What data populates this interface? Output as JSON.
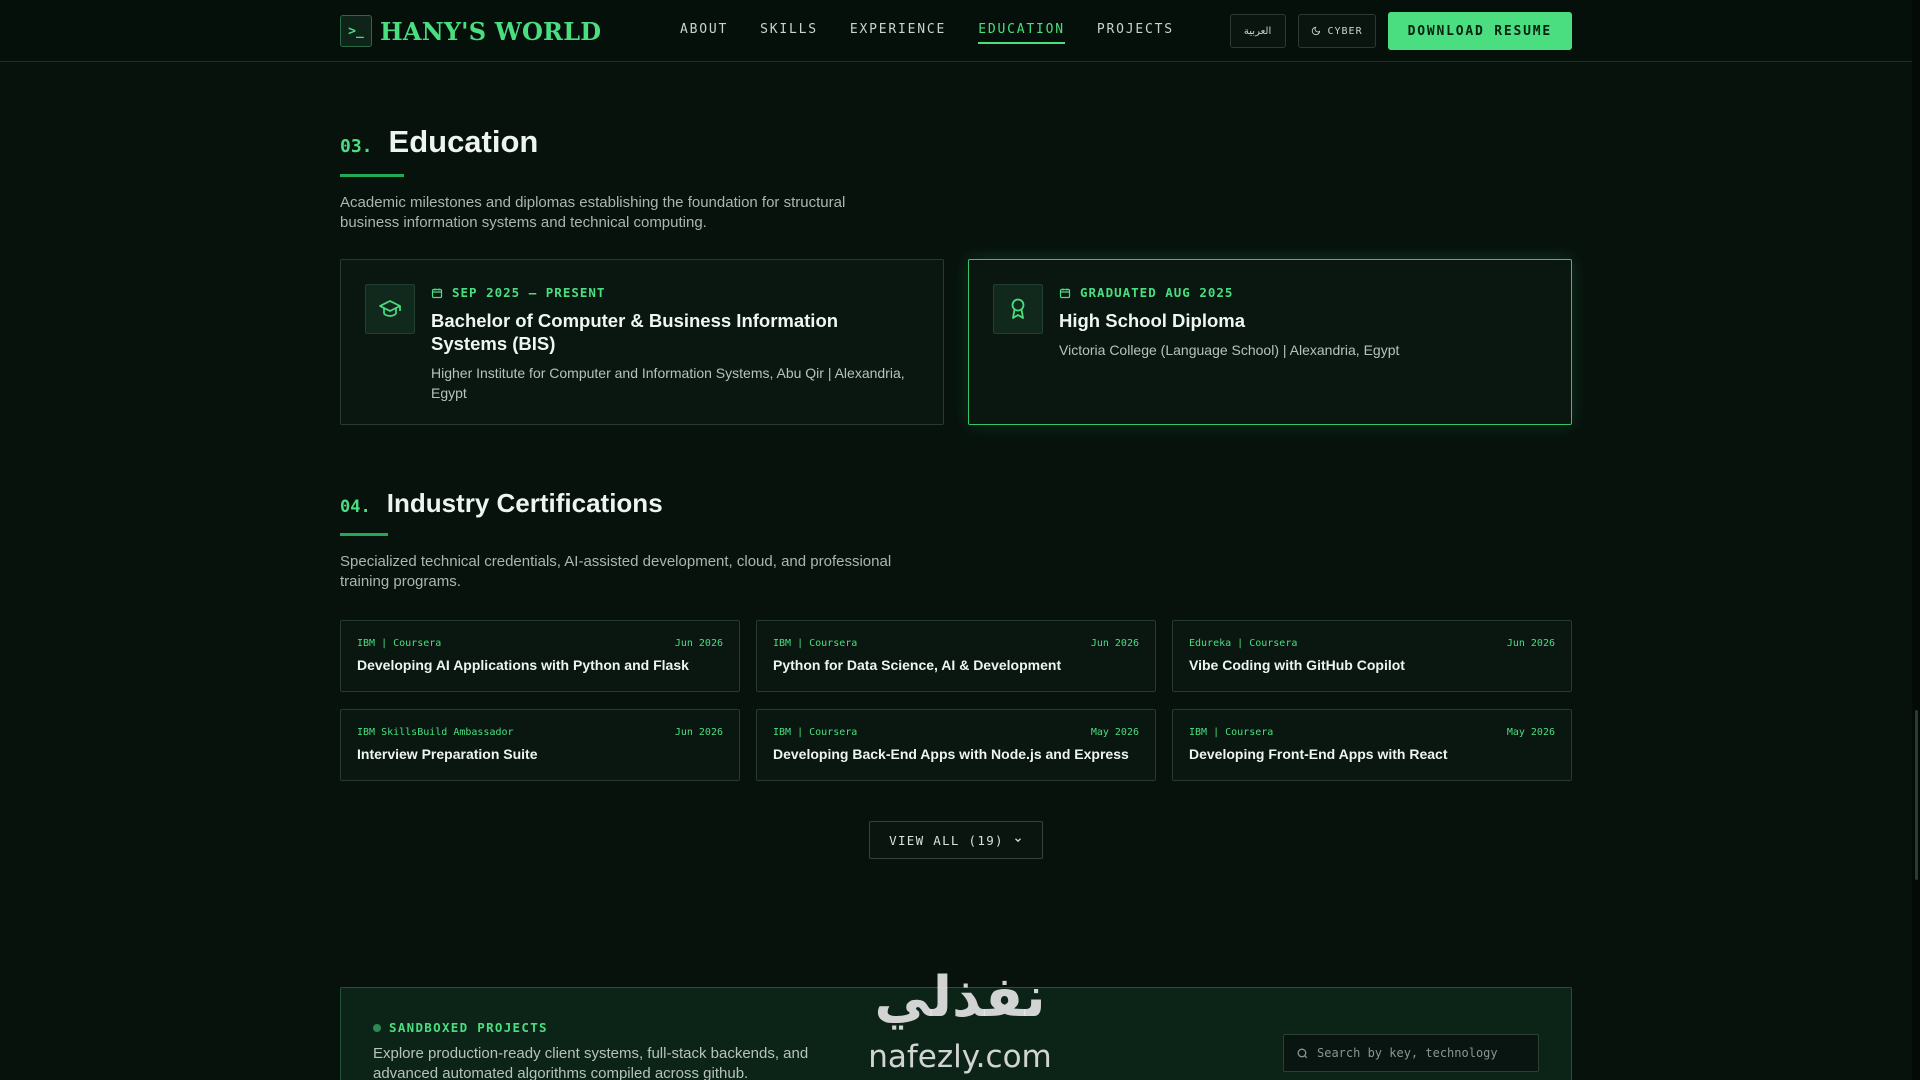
{
  "nav": {
    "brand_symbol": ">_",
    "brand": "HANY'S WORLD",
    "links": [
      "ABOUT",
      "SKILLS",
      "EXPERIENCE",
      "EDUCATION",
      "PROJECTS"
    ],
    "active_link": "EDUCATION",
    "language_button": "العربية",
    "theme_button": "CYBER",
    "download_button": "DOWNLOAD RESUME"
  },
  "education": {
    "number": "03.",
    "title": "Education",
    "description": "Academic milestones and diplomas establishing the foundation for structural business information systems and technical computing.",
    "items": [
      {
        "date": "SEP 2025 — PRESENT",
        "title": "Bachelor of Computer & Business Information Systems (BIS)",
        "institution": "Higher Institute for Computer and Information Systems, Abu Qir | Alexandria, Egypt",
        "icon": "graduation-cap-icon"
      },
      {
        "date": "GRADUATED AUG 2025",
        "title": "High School Diploma",
        "institution": "Victoria College (Language School) | Alexandria, Egypt",
        "icon": "award-icon"
      }
    ]
  },
  "certifications": {
    "number": "04.",
    "title": "Industry Certifications",
    "description": "Specialized technical credentials, AI-assisted development, cloud, and professional training programs.",
    "items": [
      {
        "issuer": "IBM | Coursera",
        "date": "Jun 2026",
        "title": "Developing AI Applications with Python and Flask"
      },
      {
        "issuer": "IBM | Coursera",
        "date": "Jun 2026",
        "title": "Python for Data Science, AI & Development"
      },
      {
        "issuer": "Edureka | Coursera",
        "date": "Jun 2026",
        "title": "Vibe Coding with GitHub Copilot"
      },
      {
        "issuer": "IBM SkillsBuild Ambassador",
        "date": "Jun 2026",
        "title": "Interview Preparation Suite"
      },
      {
        "issuer": "IBM | Coursera",
        "date": "May 2026",
        "title": "Developing Back-End Apps with Node.js and Express"
      },
      {
        "issuer": "IBM | Coursera",
        "date": "May 2026",
        "title": "Developing Front-End Apps with React"
      }
    ],
    "view_all": "VIEW ALL (19)"
  },
  "projects": {
    "label": "SANDBOXED PROJECTS",
    "description": "Explore production-ready client systems, full-stack backends, and advanced automated algorithms compiled across github.",
    "search_placeholder": "Search by key, technology"
  },
  "watermark": {
    "arabic": "نفذلي",
    "latin": "nafezly.com"
  },
  "colors": {
    "background": "#07120d",
    "accent": "#4ade80",
    "card_border": "#263a2f",
    "text": "#e6efe9"
  }
}
